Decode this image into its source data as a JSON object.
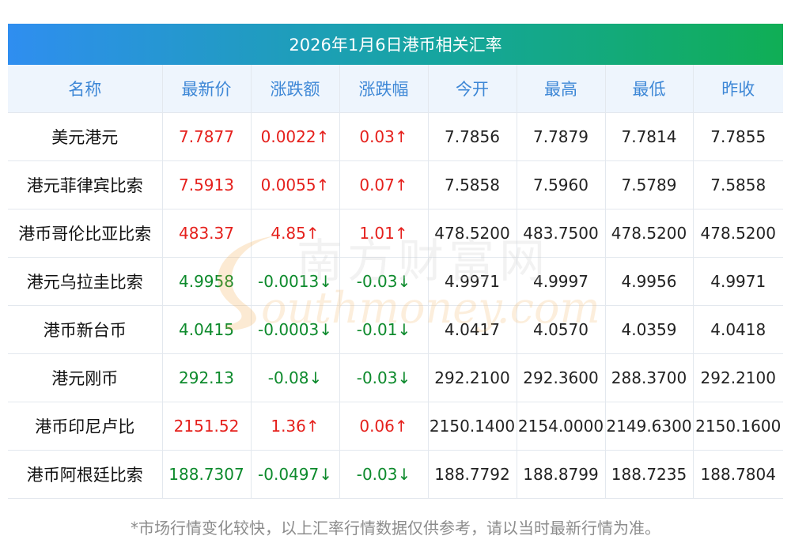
{
  "header": {
    "title": "2026年1月6日港币相关汇率"
  },
  "table": {
    "columns": [
      "名称",
      "最新价",
      "涨跌额",
      "涨跌幅",
      "今开",
      "最高",
      "最低",
      "昨收"
    ],
    "rows": [
      {
        "name": "美元港元",
        "latest": "7.7877",
        "change": "0.0022↑",
        "pct": "0.03↑",
        "open": "7.7856",
        "high": "7.7879",
        "low": "7.7814",
        "prev_close": "7.7855",
        "trend": "up"
      },
      {
        "name": "港元菲律宾比索",
        "latest": "7.5913",
        "change": "0.0055↑",
        "pct": "0.07↑",
        "open": "7.5858",
        "high": "7.5960",
        "low": "7.5789",
        "prev_close": "7.5858",
        "trend": "up"
      },
      {
        "name": "港币哥伦比亚比索",
        "latest": "483.37",
        "change": "4.85↑",
        "pct": "1.01↑",
        "open": "478.5200",
        "high": "483.7500",
        "low": "478.5200",
        "prev_close": "478.5200",
        "trend": "up"
      },
      {
        "name": "港元乌拉圭比索",
        "latest": "4.9958",
        "change": "-0.0013↓",
        "pct": "-0.03↓",
        "open": "4.9971",
        "high": "4.9997",
        "low": "4.9956",
        "prev_close": "4.9971",
        "trend": "down"
      },
      {
        "name": "港币新台币",
        "latest": "4.0415",
        "change": "-0.0003↓",
        "pct": "-0.01↓",
        "open": "4.0417",
        "high": "4.0570",
        "low": "4.0359",
        "prev_close": "4.0418",
        "trend": "down"
      },
      {
        "name": "港元刚币",
        "latest": "292.13",
        "change": "-0.08↓",
        "pct": "-0.03↓",
        "open": "292.2100",
        "high": "292.3600",
        "low": "288.3700",
        "prev_close": "292.2100",
        "trend": "down"
      },
      {
        "name": "港币印尼卢比",
        "latest": "2151.52",
        "change": "1.36↑",
        "pct": "0.06↑",
        "open": "2150.1400",
        "high": "2154.0000",
        "low": "2149.6300",
        "prev_close": "2150.1600",
        "trend": "up"
      },
      {
        "name": "港币阿根廷比索",
        "latest": "188.7307",
        "change": "-0.0497↓",
        "pct": "-0.03↓",
        "open": "188.7792",
        "high": "188.8799",
        "low": "188.7235",
        "prev_close": "188.7804",
        "trend": "down"
      }
    ]
  },
  "watermark": {
    "cn": "南方财富网",
    "en": "outhmoney.com"
  },
  "footer": {
    "note": "*市场行情变化较快，以上汇率行情数据仅供参考，请以当时最新行情为准。"
  },
  "colors": {
    "up": "#e5201c",
    "down": "#0d8a2c",
    "header_text": "#3d87d6",
    "header_bg": "#eef5fd",
    "banner_start": "#2f8ef0",
    "banner_end": "#10ae55"
  }
}
